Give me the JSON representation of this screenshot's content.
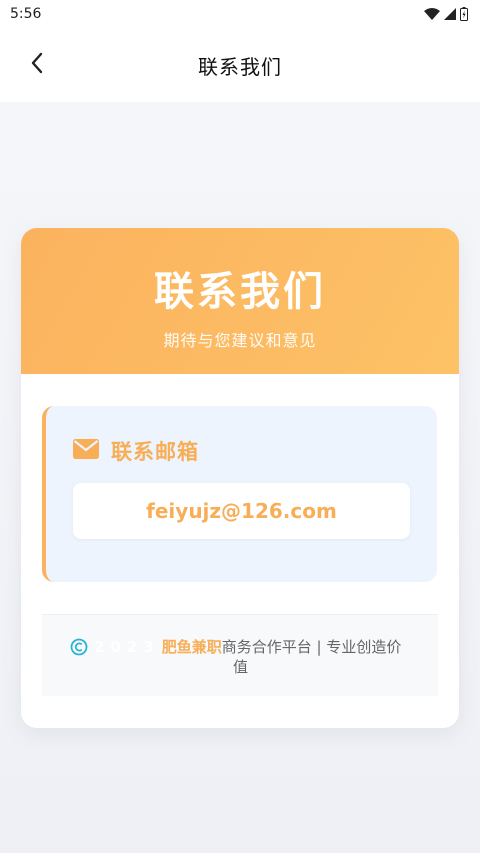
{
  "status_bar": {
    "time": "5:56"
  },
  "header": {
    "title": "联系我们"
  },
  "hero": {
    "title": "联系我们",
    "subtitle": "期待与您建议和意见"
  },
  "contact": {
    "label": "联系邮箱",
    "email": "feiyujz@126.com"
  },
  "footer": {
    "year": "2023",
    "brand": "肥鱼兼职",
    "line1": "商务合作平台 | 专业创造价",
    "line2": "值"
  },
  "colors": {
    "accent": "#f7ae57",
    "hero_start": "#fbb25e",
    "hero_end": "#fdc266",
    "panel": "#eef4fd"
  },
  "icons": [
    "wifi-icon",
    "cellular-icon",
    "battery-icon",
    "back-arrow-icon",
    "envelope-icon",
    "copyright-icon"
  ]
}
